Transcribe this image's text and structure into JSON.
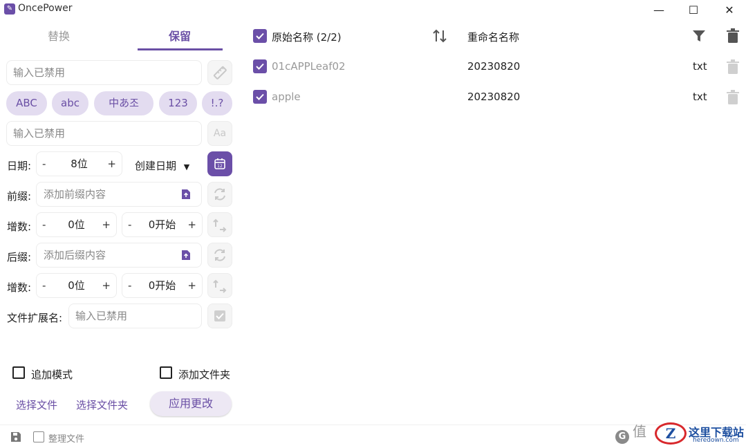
{
  "app": {
    "title": "OncePower"
  },
  "window": {
    "minimize": "—",
    "maximize": "☐",
    "close": "✕"
  },
  "tabs": [
    {
      "label": "替换"
    },
    {
      "label": "保留"
    }
  ],
  "rule_input": {
    "placeholder": "输入已禁用"
  },
  "chips": [
    "ABC",
    "abc",
    "中あ조",
    "123",
    "!.?"
  ],
  "case_input": {
    "placeholder": "输入已禁用"
  },
  "date_row": {
    "label": "日期:",
    "minus": "-",
    "value": "8位",
    "plus": "+",
    "select": "创建日期"
  },
  "prefix_row": {
    "label": "前缀:",
    "placeholder": "添加前缀内容"
  },
  "prefix_increment": {
    "label": "增数:",
    "digits": "0位",
    "start": "0开始",
    "minus": "-",
    "plus": "+"
  },
  "suffix_row": {
    "label": "后缀:",
    "placeholder": "添加后缀内容"
  },
  "suffix_increment": {
    "label": "增数:",
    "digits": "0位",
    "start": "0开始",
    "minus": "-",
    "plus": "+"
  },
  "extension_row": {
    "label": "文件扩展名:",
    "placeholder": "输入已禁用"
  },
  "options": {
    "append_mode": "追加模式",
    "add_folder": "添加文件夹"
  },
  "actions": {
    "select_files": "选择文件",
    "select_folder": "选择文件夹",
    "apply": "应用更改"
  },
  "footer": {
    "organize": "整理文件"
  },
  "table": {
    "header": {
      "original": "原始名称 (2/2)",
      "renamed": "重命名名称"
    },
    "rows": [
      {
        "original": "01cAPPLeaf02",
        "renamed": "20230820",
        "ext": "txt"
      },
      {
        "original": "apple",
        "renamed": "20230820",
        "ext": "txt"
      }
    ]
  },
  "watermark": {
    "text": "这里下载站",
    "domain": "heredown.com",
    "left_glyph": "值",
    "letter_g": "G",
    "letter_z": "Z"
  },
  "colors": {
    "accent": "#6b4fa8",
    "chip_bg": "#e3dcf0",
    "muted": "#999999"
  }
}
